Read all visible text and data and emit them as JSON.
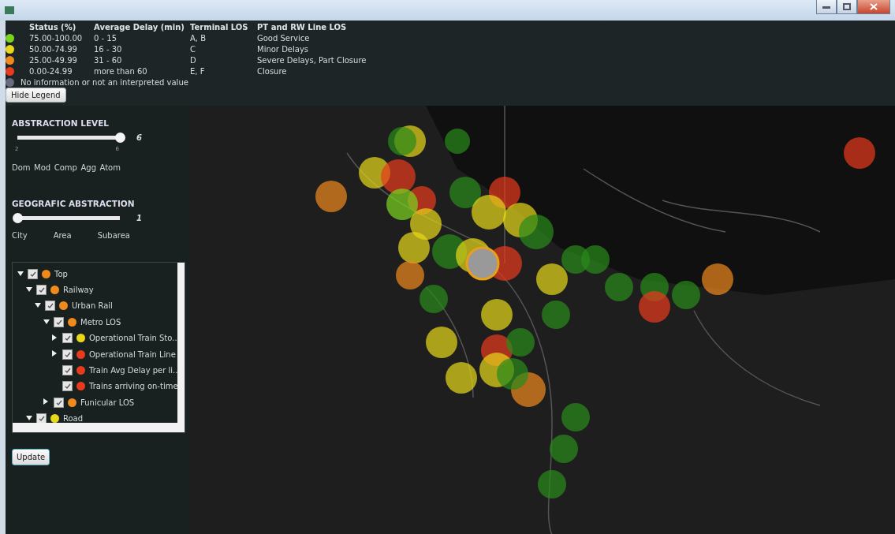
{
  "legend": {
    "headers": [
      "Status (%)",
      "Average Delay (min)",
      "Terminal LOS",
      "PT and RW Line LOS"
    ],
    "rows": [
      {
        "color": "#7ad41e",
        "status": "75.00-100.00",
        "delay": "0 - 15",
        "terminal": "A, B",
        "line": "Good Service"
      },
      {
        "color": "#e8d81a",
        "status": "50.00-74.99",
        "delay": "16 - 30",
        "terminal": "C",
        "line": "Minor Delays"
      },
      {
        "color": "#f08a1c",
        "status": "25.00-49.99",
        "delay": "31 - 60",
        "terminal": "D",
        "line": "Severe Delays, Part Closure"
      },
      {
        "color": "#e83a1c",
        "status": "0.00-24.99",
        "delay": "more than 60",
        "terminal": "E, F",
        "line": "Closure"
      }
    ],
    "no_info": {
      "color": "#6a6a80",
      "text": "No information or not an interpreted value"
    },
    "hide_button": "Hide Legend"
  },
  "abstraction": {
    "title": "ABSTRACTION LEVEL",
    "level": 1,
    "value": "6",
    "tick_min": "2",
    "tick_max": "6",
    "labels": [
      "Dom",
      "Mod",
      "Comp",
      "Agg",
      "Atom"
    ]
  },
  "geographic": {
    "title": "GEOGRAFIC ABSTRACTION",
    "level": 0,
    "value": "1",
    "labels": [
      "City",
      "Area",
      "Subarea"
    ]
  },
  "tree": [
    {
      "label": "Top",
      "checked": true,
      "color": "#f08a1c",
      "expanded": true,
      "children": [
        {
          "label": "Railway",
          "checked": true,
          "color": "#f08a1c",
          "expanded": true,
          "children": [
            {
              "label": "Urban Rail",
              "checked": true,
              "color": "#f08a1c",
              "expanded": true,
              "children": [
                {
                  "label": "Metro LOS",
                  "checked": true,
                  "color": "#f08a1c",
                  "expanded": true,
                  "children": [
                    {
                      "label": "Operational Train Sto..",
                      "checked": true,
                      "color": "#e8d81a",
                      "expanded": false
                    },
                    {
                      "label": "Operational Train Line",
                      "checked": true,
                      "color": "#e83a1c",
                      "expanded": false
                    },
                    {
                      "label": "Train Avg Delay per li..",
                      "checked": true,
                      "color": "#e83a1c"
                    },
                    {
                      "label": "Trains arriving on-time",
                      "checked": true,
                      "color": "#e83a1c"
                    }
                  ]
                },
                {
                  "label": "Funicular LOS",
                  "checked": true,
                  "color": "#f08a1c",
                  "expanded": false
                }
              ]
            }
          ]
        },
        {
          "label": "Road",
          "checked": true,
          "color": "#e8d81a",
          "expanded": true
        }
      ]
    }
  ],
  "update_button": "Update"
}
